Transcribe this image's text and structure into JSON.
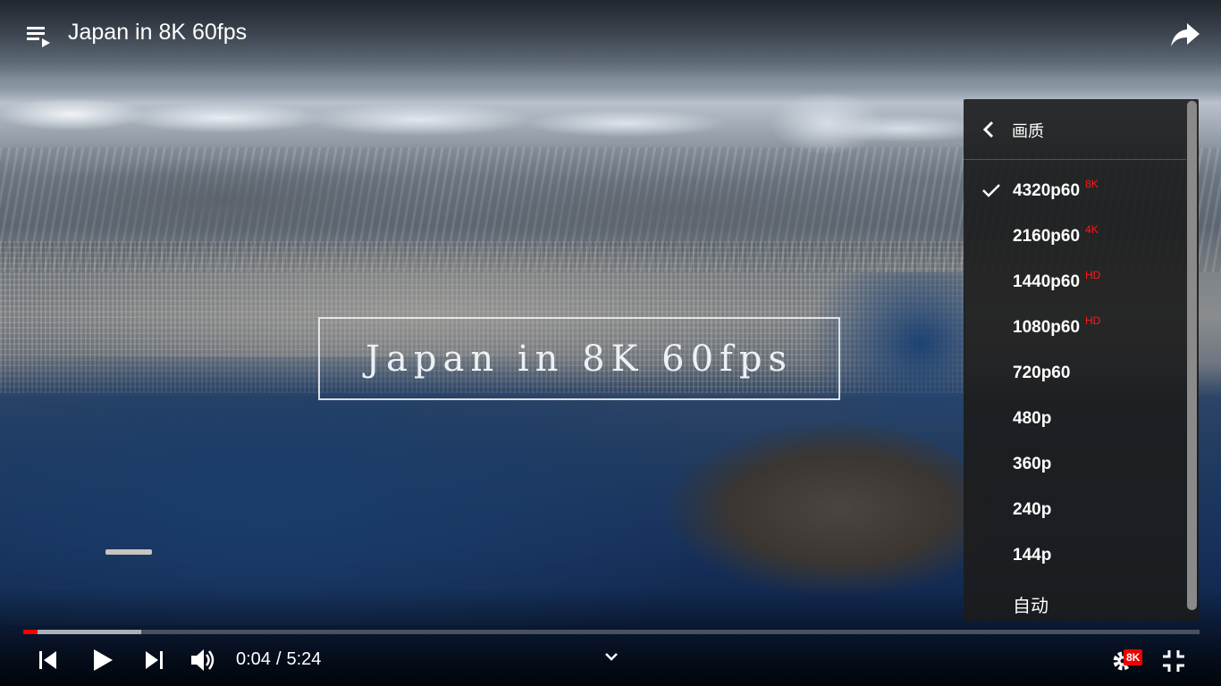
{
  "player": {
    "title": "Japan in 8K 60fps",
    "overlay_text": "Japan in 8K 60fps"
  },
  "icons": {
    "playlist": "playlist-icon",
    "share": "share-icon",
    "previous": "skip-previous-icon",
    "play": "play-icon",
    "next": "skip-next-icon",
    "volume": "volume-icon",
    "collapse": "chevron-down-icon",
    "settings": "gear-icon",
    "exit_fullscreen": "exit-fullscreen-icon"
  },
  "quality_menu": {
    "header": "画质",
    "items": [
      {
        "label": "4320p60",
        "badge": "8K",
        "selected": true
      },
      {
        "label": "2160p60",
        "badge": "4K",
        "selected": false
      },
      {
        "label": "1440p60",
        "badge": "HD",
        "selected": false
      },
      {
        "label": "1080p60",
        "badge": "HD",
        "selected": false
      },
      {
        "label": "720p60",
        "badge": "",
        "selected": false
      },
      {
        "label": "480p",
        "badge": "",
        "selected": false
      },
      {
        "label": "360p",
        "badge": "",
        "selected": false
      },
      {
        "label": "240p",
        "badge": "",
        "selected": false
      },
      {
        "label": "144p",
        "badge": "",
        "selected": false
      },
      {
        "label": "自动",
        "badge": "",
        "selected": false
      }
    ]
  },
  "progress": {
    "played_fraction": 0.0125,
    "buffered_fraction": 0.1
  },
  "controls": {
    "current_time": "0:04",
    "separator": "/",
    "duration": "5:24",
    "settings_badge": "8K"
  },
  "colors": {
    "accent": "#ff0000",
    "badge": "#ff1a1a",
    "menu_bg": "#1c1c1c"
  }
}
